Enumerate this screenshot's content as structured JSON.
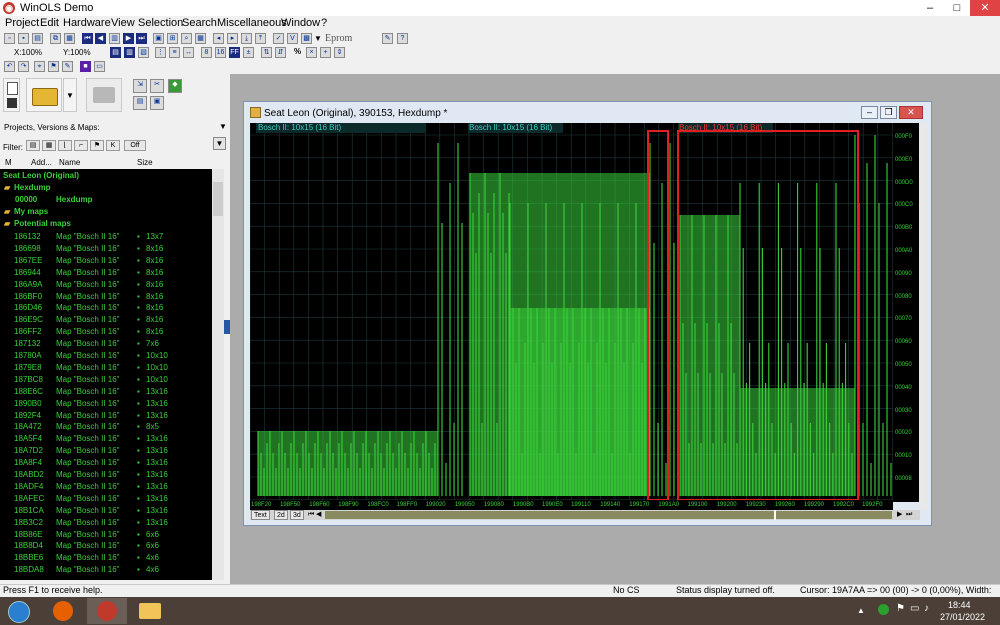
{
  "window": {
    "title": "WinOLS Demo",
    "app_icon": "winols-icon"
  },
  "menu": [
    "Project",
    "Edit",
    "Hardware",
    "View",
    "Selection",
    "Search",
    "Miscellaneous",
    "Window",
    "?"
  ],
  "toolbar": {
    "x_zoom": "X:100%",
    "y_zoom": "Y:100%",
    "eprom_label": "Eprom",
    "percent_label": "%",
    "hex_ff": "FF"
  },
  "left_panel": {
    "section_label": "Projects, Versions & Maps:",
    "filter_label": "Filter:",
    "filter_off": "Off",
    "columns": [
      "M",
      "Add...",
      "Name",
      "Size"
    ],
    "tree": [
      {
        "label": "Seat Leon (Original)",
        "level": 0
      },
      {
        "label": "Hexdump",
        "level": 1
      },
      {
        "addr": "00000",
        "label": "Hexdump",
        "level": 2
      },
      {
        "label": "My maps",
        "level": 1
      },
      {
        "label": "Potential maps",
        "level": 1
      }
    ],
    "maps": [
      {
        "addr": "186132",
        "name": "Map \"Bosch II 16\"",
        "size": "13x7"
      },
      {
        "addr": "186698",
        "name": "Map \"Bosch II 16\"",
        "size": "8x16"
      },
      {
        "addr": "1867EE",
        "name": "Map \"Bosch II 16\"",
        "size": "8x16"
      },
      {
        "addr": "186944",
        "name": "Map \"Bosch II 16\"",
        "size": "8x16"
      },
      {
        "addr": "186A9A",
        "name": "Map \"Bosch II 16\"",
        "size": "8x16"
      },
      {
        "addr": "186BF0",
        "name": "Map \"Bosch II 16\"",
        "size": "8x16"
      },
      {
        "addr": "186D46",
        "name": "Map \"Bosch II 16\"",
        "size": "8x16"
      },
      {
        "addr": "186E9C",
        "name": "Map \"Bosch II 16\"",
        "size": "8x16"
      },
      {
        "addr": "186FF2",
        "name": "Map \"Bosch II 16\"",
        "size": "8x16"
      },
      {
        "addr": "187132",
        "name": "Map \"Bosch II 16\"",
        "size": "7x6"
      },
      {
        "addr": "18780A",
        "name": "Map \"Bosch II 16\"",
        "size": "10x10"
      },
      {
        "addr": "1879E8",
        "name": "Map \"Bosch II 16\"",
        "size": "10x10"
      },
      {
        "addr": "187BC8",
        "name": "Map \"Bosch II 16\"",
        "size": "10x10"
      },
      {
        "addr": "188E6C",
        "name": "Map \"Bosch II 16\"",
        "size": "13x16"
      },
      {
        "addr": "1890B0",
        "name": "Map \"Bosch II 16\"",
        "size": "13x16"
      },
      {
        "addr": "1892F4",
        "name": "Map \"Bosch II 16\"",
        "size": "13x16"
      },
      {
        "addr": "18A472",
        "name": "Map \"Bosch II 16\"",
        "size": "8x5"
      },
      {
        "addr": "18A5F4",
        "name": "Map \"Bosch II 16\"",
        "size": "13x16"
      },
      {
        "addr": "18A7D2",
        "name": "Map \"Bosch II 16\"",
        "size": "13x16"
      },
      {
        "addr": "18A8F4",
        "name": "Map \"Bosch II 16\"",
        "size": "13x16"
      },
      {
        "addr": "18ABD2",
        "name": "Map \"Bosch II 16\"",
        "size": "13x16"
      },
      {
        "addr": "18ADF4",
        "name": "Map \"Bosch II 16\"",
        "size": "13x16"
      },
      {
        "addr": "18AFEC",
        "name": "Map \"Bosch II 16\"",
        "size": "13x16"
      },
      {
        "addr": "18B1CA",
        "name": "Map \"Bosch II 16\"",
        "size": "13x16"
      },
      {
        "addr": "18B3C2",
        "name": "Map \"Bosch II 16\"",
        "size": "13x16"
      },
      {
        "addr": "18B86E",
        "name": "Map \"Bosch II 16\"",
        "size": "6x6"
      },
      {
        "addr": "18B8D4",
        "name": "Map \"Bosch II 16\"",
        "size": "6x6"
      },
      {
        "addr": "18BBE6",
        "name": "Map \"Bosch II 16\"",
        "size": "4x6"
      },
      {
        "addr": "18BDA8",
        "name": "Map \"Bosch II 16\"",
        "size": "4x6"
      }
    ]
  },
  "child_window": {
    "title": "Seat Leon (Original), 390153, Hexdump *",
    "map_labels": [
      {
        "text": "Bosch II: 10x15 (16 Bit)",
        "color": "#3ad1c8"
      },
      {
        "text": "Bosch II: 10x15 (16 Bit)",
        "color": "#3ad1c8"
      },
      {
        "text": "Bosch II: 10x15 (16 Bit)",
        "color": "#ff3030"
      }
    ],
    "y_ticks": [
      "000F0",
      "000E0",
      "000D0",
      "000C0",
      "000B0",
      "000A0",
      "00090",
      "00080",
      "00070",
      "00060",
      "00050",
      "00040",
      "00030",
      "00020",
      "00010",
      "00008"
    ],
    "x_ticks": [
      "198F20",
      "198F50",
      "198F60",
      "198F90",
      "198FC0",
      "198FF0",
      "199020",
      "199050",
      "199080",
      "1990B0",
      "1990E0",
      "199110",
      "199140",
      "199170",
      "1991A0",
      "199100",
      "199200",
      "199230",
      "199260",
      "199290",
      "1992C0",
      "1992F0"
    ],
    "tabs": [
      "Text",
      "2d",
      "3d"
    ]
  },
  "status": {
    "help": "Press F1 to receive help.",
    "cs": "No CS",
    "display": "Status display turned off.",
    "cursor": "Cursor: 19A7AA => 00 (00) -> 0 (0,00%), Width: 16"
  },
  "taskbar": {
    "time": "18:44",
    "date": "27/01/2022"
  },
  "colors": {
    "green": "#3ad13a",
    "cyan_label": "#3ad1c8",
    "selection_red": "#e02020",
    "plot_bg": "#000000"
  }
}
